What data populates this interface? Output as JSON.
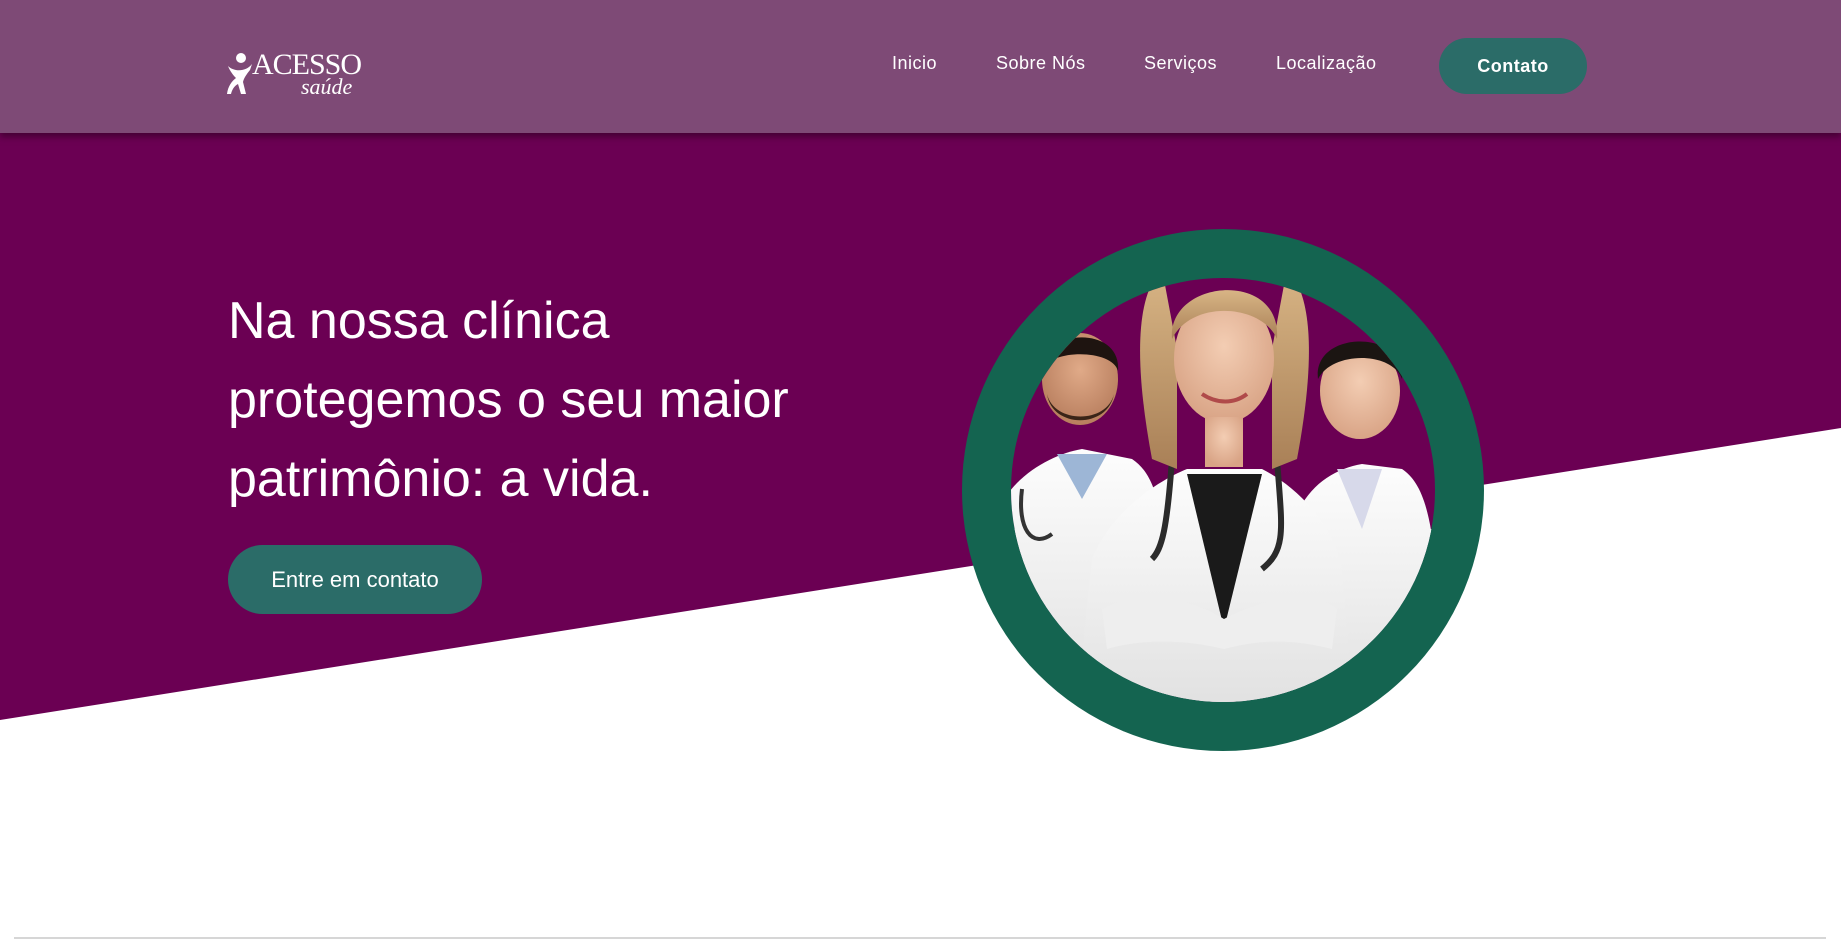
{
  "brand": {
    "name": "ACESSO",
    "tagline": "saúde"
  },
  "nav": {
    "items": [
      {
        "label": "Inicio"
      },
      {
        "label": "Sobre Nós"
      },
      {
        "label": "Serviços"
      },
      {
        "label": "Localização"
      }
    ],
    "cta_label": "Contato"
  },
  "hero": {
    "headline_lines": [
      "Na nossa clínica",
      "protegemos o seu maior",
      "patrimônio: a vida."
    ],
    "cta_label": "Entre em contato",
    "image_alt": "doctors-team-photo"
  },
  "colors": {
    "nav_bg": "#7e4a76",
    "hero_bg": "#6b0053",
    "accent_green": "#2b6c68",
    "ring_green": "#146450",
    "background": "#ffffff"
  }
}
